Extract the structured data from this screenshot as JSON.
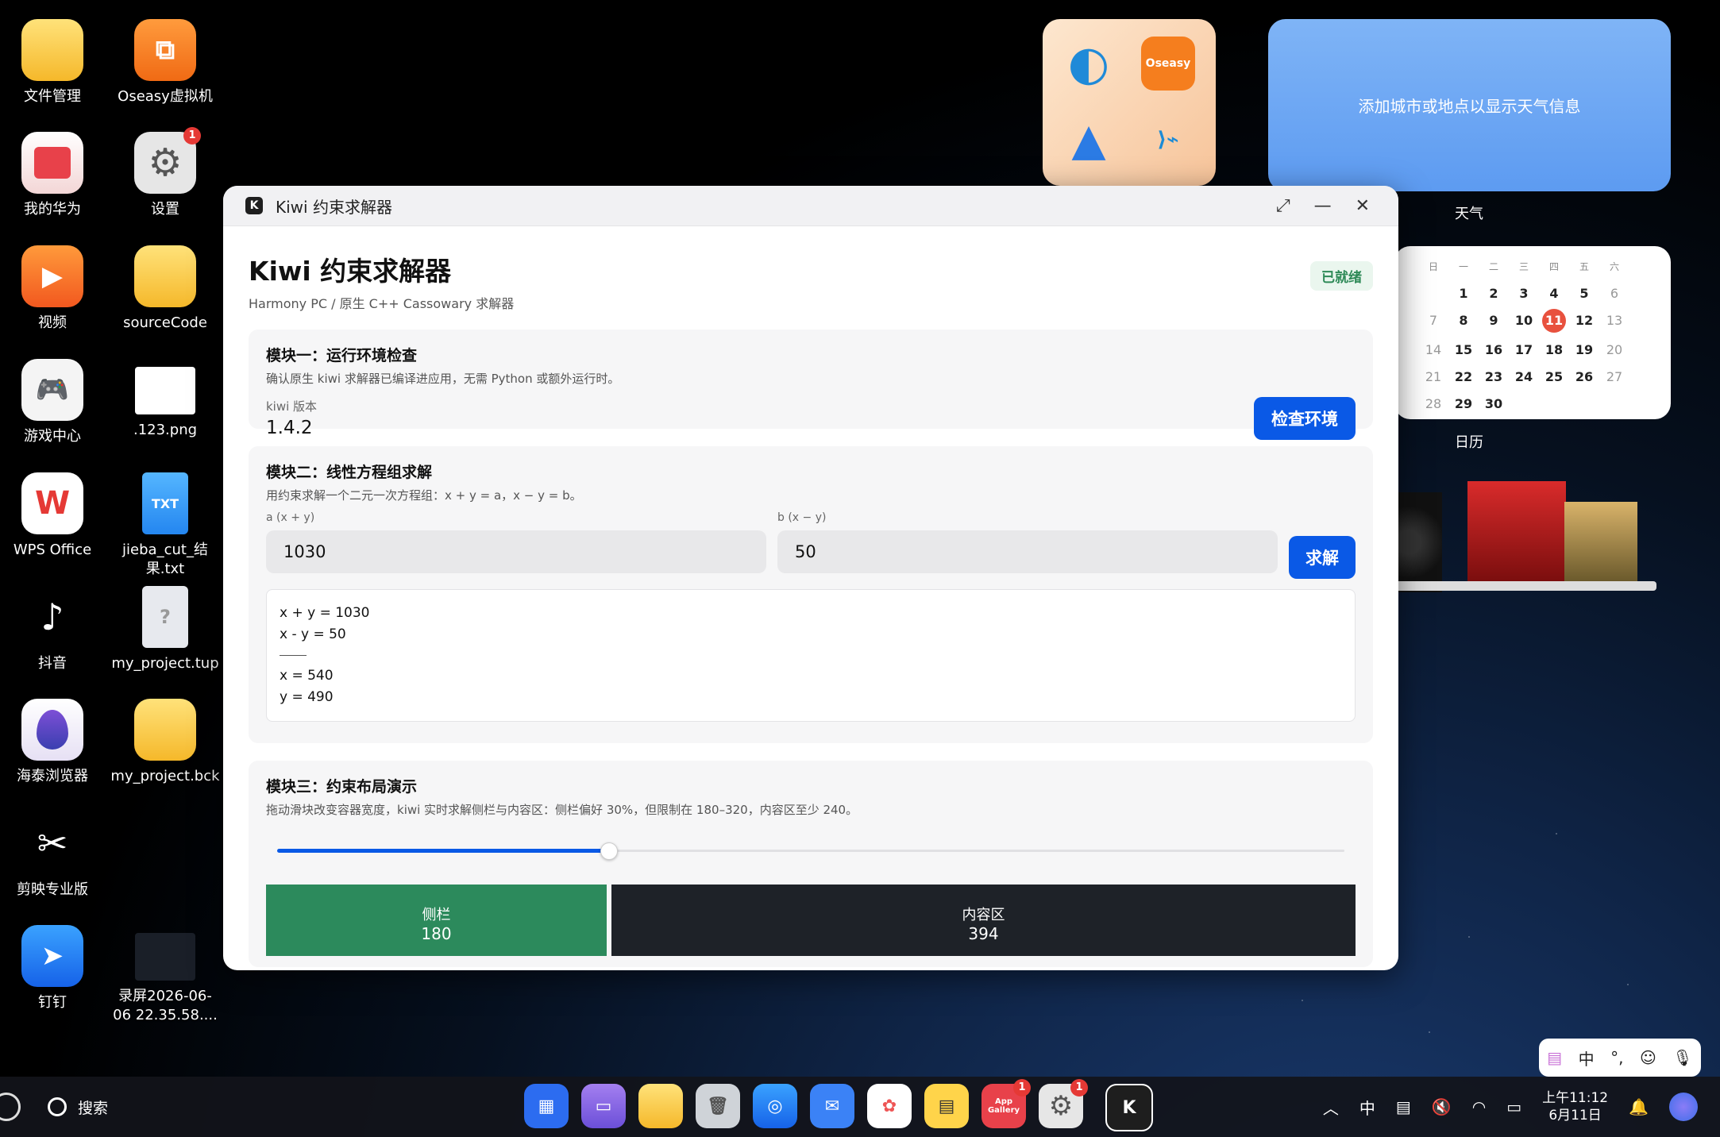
{
  "desktop": {
    "icons": [
      {
        "label": "文件管理"
      },
      {
        "label": "Oseasy虚拟机"
      },
      {
        "label": "我的华为"
      },
      {
        "label": "设置",
        "badge": "1"
      },
      {
        "label": "视频"
      },
      {
        "label": "sourceCode"
      },
      {
        "label": "游戏中心"
      },
      {
        "label": ".123.png"
      },
      {
        "label": "WPS Office"
      },
      {
        "label": "jieba_cut_结果.txt"
      },
      {
        "label": "抖音"
      },
      {
        "label": "my_project.tup"
      },
      {
        "label": "海泰浏览器"
      },
      {
        "label": "my_project.bck"
      },
      {
        "label": "剪映专业版"
      },
      {
        "label": "钉钉"
      },
      {
        "label": "录屏2026-06-06 22.35.58...."
      }
    ],
    "txt_glyph": "TXT",
    "oseasy_widget_label": "Oseasy"
  },
  "widgets": {
    "weather_text": "添加城市或地点以显示天气信息",
    "weather_label": "天气",
    "calendar_label": "日历",
    "calendar": {
      "headers": [
        "日",
        "一",
        "二",
        "三",
        "四",
        "五",
        "六"
      ],
      "days": [
        "",
        "1",
        "2",
        "3",
        "4",
        "5",
        "6",
        "7",
        "8",
        "9",
        "10",
        "11",
        "12",
        "13",
        "14",
        "15",
        "16",
        "17",
        "18",
        "19",
        "20",
        "21",
        "22",
        "23",
        "24",
        "25",
        "26",
        "27",
        "28",
        "29",
        "30"
      ],
      "today": "11"
    }
  },
  "window": {
    "title": "Kiwi 约束求解器",
    "app_icon_letter": "K",
    "heading": "Kiwi 约束求解器",
    "subtitle": "Harmony PC / 原生 C++ Cassowary 求解器",
    "status": "已就绪",
    "module1": {
      "title": "模块一：运行环境检查",
      "desc": "确认原生 kiwi 求解器已编译进应用，无需 Python 或额外运行时。",
      "version_label": "kiwi 版本",
      "version": "1.4.2",
      "button": "检查环境"
    },
    "module2": {
      "title": "模块二：线性方程组求解",
      "desc": "用约束求解一个二元一次方程组：x + y = a，x − y = b。",
      "a_label": "a (x + y)",
      "a_value": "1030",
      "b_label": "b (x − y)",
      "b_value": "50",
      "button": "求解",
      "result_lines": [
        "x + y = 1030",
        "x - y = 50"
      ],
      "solution_lines": [
        "x = 540",
        "y = 490"
      ]
    },
    "module3": {
      "title": "模块三：约束布局演示",
      "desc": "拖动滑块改变容器宽度，kiwi 实时求解侧栏与内容区：侧栏偏好 30%，但限制在 180–320，内容区至少 240。",
      "slider_fraction": 0.31,
      "sidebar_label": "侧栏",
      "sidebar_value": "180",
      "content_label": "内容区",
      "content_value": "394"
    }
  },
  "ime": {
    "items": [
      "中",
      "°,"
    ]
  },
  "taskbar": {
    "search_label": "搜索",
    "time": "上午11:12",
    "date": "6月11日",
    "app_gallery_label": "App Gallery",
    "dock_badge": "1",
    "tray_ime": "中"
  }
}
